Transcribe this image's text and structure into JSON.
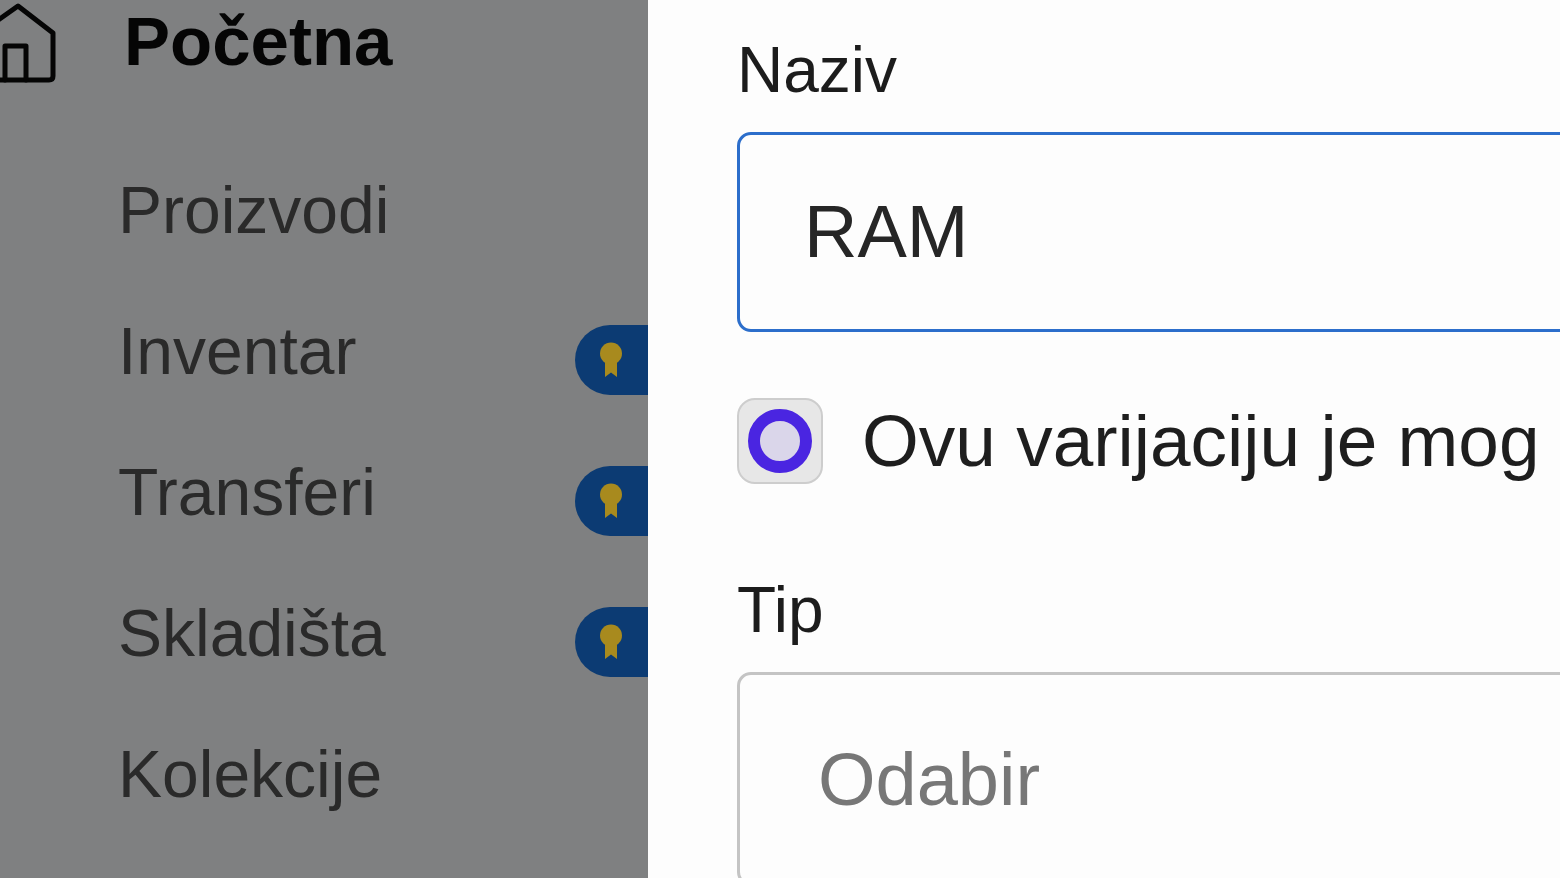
{
  "sidebar": {
    "items": [
      {
        "label": "Početna",
        "kind": "main",
        "upgrade_badge": false
      },
      {
        "label": "Proizvodi",
        "kind": "sub",
        "upgrade_badge": false
      },
      {
        "label": "Inventar",
        "kind": "sub",
        "upgrade_badge": true
      },
      {
        "label": "Transferi",
        "kind": "sub",
        "upgrade_badge": true
      },
      {
        "label": "Skladišta",
        "kind": "sub",
        "upgrade_badge": true
      },
      {
        "label": "Kolekcije",
        "kind": "sub",
        "upgrade_badge": false
      }
    ]
  },
  "form": {
    "name_field": {
      "label": "Naziv",
      "value": "RAM",
      "focused": true
    },
    "variation_option": {
      "label": "Ovu varijaciju je mog",
      "checked": true
    },
    "type_field": {
      "label": "Tip",
      "placeholder": "Odabir"
    }
  }
}
